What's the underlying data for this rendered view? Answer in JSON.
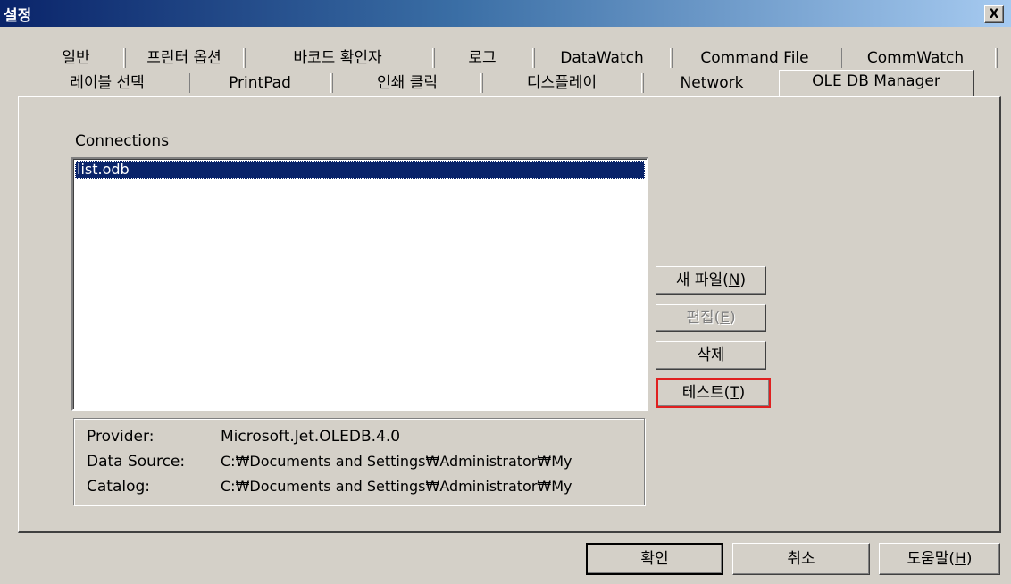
{
  "window": {
    "title": "설정",
    "close_label": "X"
  },
  "tabs": {
    "row1": [
      "일반",
      "프린터 옵션",
      "바코드 확인자",
      "로그",
      "DataWatch",
      "Command File",
      "CommWatch"
    ],
    "row2": [
      "레이블 선택",
      "PrintPad",
      "인쇄 클릭",
      "디스플레이",
      "Network",
      "OLE DB Manager"
    ],
    "active": "OLE DB Manager"
  },
  "connections": {
    "label": "Connections",
    "items": [
      "list.odb"
    ],
    "selected": "list.odb"
  },
  "details": {
    "provider_label": "Provider:",
    "provider_value": "Microsoft.Jet.OLEDB.4.0",
    "data_source_label": "Data Source:",
    "data_source_value": "C:₩Documents and Settings₩Administrator₩My",
    "catalog_label": "Catalog:",
    "catalog_value": "C:₩Documents and Settings₩Administrator₩My"
  },
  "side_buttons": {
    "new_file": {
      "text": "새 파일(",
      "key": "N",
      "suffix": ")"
    },
    "edit": {
      "text": "편집(",
      "key": "E",
      "suffix": ")"
    },
    "delete": {
      "text": "삭제"
    },
    "test": {
      "text": "테스트(",
      "key": "T",
      "suffix": ")"
    }
  },
  "bottom_buttons": {
    "ok": "확인",
    "cancel": "취소",
    "help": {
      "text": "도움말(",
      "key": "H",
      "suffix": ")"
    }
  }
}
